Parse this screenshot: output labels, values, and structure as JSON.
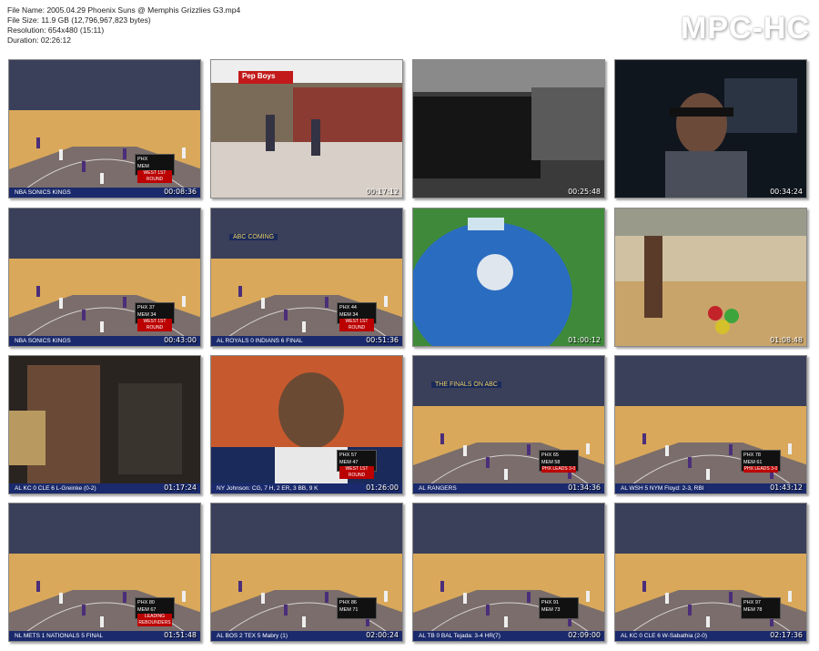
{
  "info": {
    "file_name": "File Name: 2005.04.29 Phoenix Suns @ Memphis Grizzlies G3.mp4",
    "file_size": "File Size: 11.9 GB (12,796,967,823 bytes)",
    "resolution": "Resolution: 654x480 (15:11)",
    "duration": "Duration: 02:26:12"
  },
  "brand": "MPC-HC",
  "thumbnails": [
    {
      "time": "00:08:36",
      "ticker": "NBA SONICS KINGS",
      "score": [
        "PHX",
        "MEM",
        "WEST 1ST ROUND"
      ]
    },
    {
      "time": "00:17:12",
      "sign": "Pep Boys"
    },
    {
      "time": "00:25:48"
    },
    {
      "time": "00:34:24"
    },
    {
      "time": "00:43:00",
      "ticker": "NBA SONICS KINGS",
      "score": [
        "PHX 37",
        "MEM 34",
        "WEST 1ST ROUND"
      ]
    },
    {
      "time": "00:51:36",
      "ticker": "AL ROYALS 0 INDIANS 6 FINAL",
      "score": [
        "PHX 44",
        "MEM 34",
        "WEST 1ST ROUND"
      ],
      "banner": "ABC COMING"
    },
    {
      "time": "01:00:12"
    },
    {
      "time": "01:08:48"
    },
    {
      "time": "01:17:24",
      "ticker": "AL KC 0 CLE 6 L-Greinke (0-2)"
    },
    {
      "time": "01:26:00",
      "ticker": "NY Johnson: CG, 7 H, 2 ER, 3 BB, 9 K",
      "score": [
        "PHX 57",
        "MEM 47",
        "WEST 1ST ROUND"
      ]
    },
    {
      "time": "01:34:36",
      "ticker": "AL RANGERS",
      "score": [
        "PHX 65",
        "MEM 58",
        "PHX LEADS 3-0"
      ],
      "banner": "THE FINALS ON ABC"
    },
    {
      "time": "01:43:12",
      "ticker": "AL WSH 5 NYM Floyd: 2-3, RBI",
      "score": [
        "PHX 78",
        "MEM 61",
        "PHX LEADS 3-0"
      ]
    },
    {
      "time": "01:51:48",
      "ticker": "NL METS 1 NATIONALS 5 FINAL",
      "score": [
        "PHX 80",
        "MEM 67",
        "LEADING REBOUNDERS"
      ]
    },
    {
      "time": "02:00:24",
      "ticker": "AL BOS 2 TEX 5 Mabry (1)",
      "score": [
        "PHX 86",
        "MEM 71",
        ""
      ]
    },
    {
      "time": "02:09:00",
      "ticker": "AL TB 0 BAL Tejada: 3-4 HR(7)",
      "score": [
        "PHX 91",
        "MEM 73",
        ""
      ]
    },
    {
      "time": "02:17:36",
      "ticker": "AL KC 0 CLE 6 W-Sabathia (2-0)",
      "score": [
        "PHX 97",
        "MEM 78",
        ""
      ]
    }
  ],
  "colors": {
    "court": "#d9a85a",
    "paint": "#2b3d7a",
    "crowd": "#3a3f5a",
    "ticker": "#1a2a6c"
  }
}
